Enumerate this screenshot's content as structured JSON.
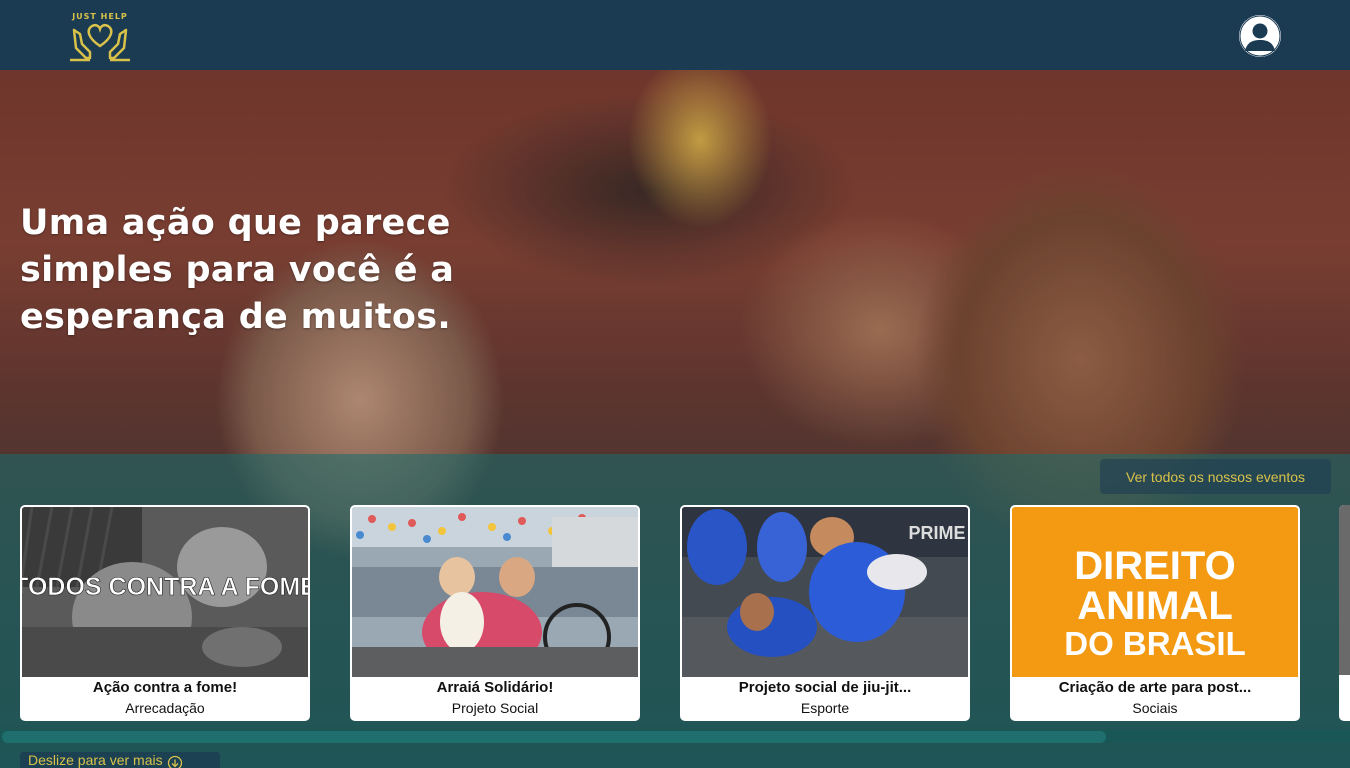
{
  "header": {
    "logo_text": "JUST HELP",
    "profile_icon": "user-avatar-icon"
  },
  "hero": {
    "headline": "Uma ação que parece simples para você é a esperança de muitos."
  },
  "events": {
    "see_all_label": "Ver todos os nossos eventos",
    "cards": [
      {
        "title": "Ação contra a fome!",
        "tag": "Arrecadação",
        "image_text": "TODOS CONTRA A FOME"
      },
      {
        "title": "Arraiá Solidário!",
        "tag": "Projeto Social"
      },
      {
        "title": "Projeto social de jiu-jit...",
        "tag": "Esporte",
        "image_text": "PRIME"
      },
      {
        "title": "Criação de arte para post...",
        "tag": "Sociais",
        "image_text": [
          "DIREITO",
          "ANIMAL",
          "DO BRASIL"
        ]
      }
    ],
    "scroll_hint": "Deslize para ver mais"
  },
  "colors": {
    "header_bg": "#1b3b52",
    "accent_yellow": "#d9c24a",
    "panel_teal": "#166e6e",
    "orange_card": "#f39a12"
  }
}
